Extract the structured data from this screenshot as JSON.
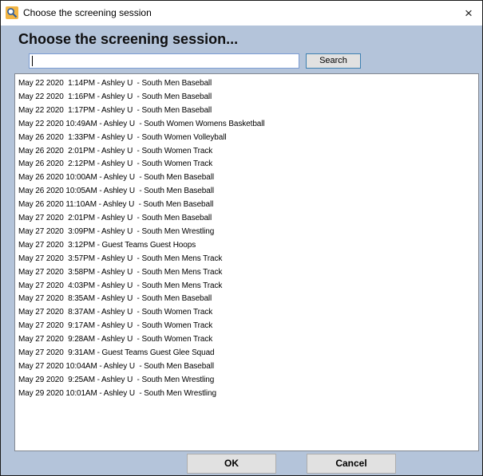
{
  "window": {
    "title": "Choose the screening session",
    "close_glyph": "×",
    "app_icon": "magnifier-icon"
  },
  "header": {
    "heading": "Choose the screening session..."
  },
  "search": {
    "value": "",
    "button_label": "Search"
  },
  "sessions": [
    "May 22 2020  1:14PM - Ashley U  - South Men Baseball",
    "May 22 2020  1:16PM - Ashley U  - South Men Baseball",
    "May 22 2020  1:17PM - Ashley U  - South Men Baseball",
    "May 22 2020 10:49AM - Ashley U  - South Women Womens Basketball",
    "May 26 2020  1:33PM - Ashley U  - South Women Volleyball",
    "May 26 2020  2:01PM - Ashley U  - South Women Track",
    "May 26 2020  2:12PM - Ashley U  - South Women Track",
    "May 26 2020 10:00AM - Ashley U  - South Men Baseball",
    "May 26 2020 10:05AM - Ashley U  - South Men Baseball",
    "May 26 2020 11:10AM - Ashley U  - South Men Baseball",
    "May 27 2020  2:01PM - Ashley U  - South Men Baseball",
    "May 27 2020  3:09PM - Ashley U  - South Men Wrestling",
    "May 27 2020  3:12PM - Guest Teams Guest Hoops",
    "May 27 2020  3:57PM - Ashley U  - South Men Mens Track",
    "May 27 2020  3:58PM - Ashley U  - South Men Mens Track",
    "May 27 2020  4:03PM - Ashley U  - South Men Mens Track",
    "May 27 2020  8:35AM - Ashley U  - South Men Baseball",
    "May 27 2020  8:37AM - Ashley U  - South Women Track",
    "May 27 2020  9:17AM - Ashley U  - South Women Track",
    "May 27 2020  9:28AM - Ashley U  - South Women Track",
    "May 27 2020  9:31AM - Guest Teams Guest Glee Squad",
    "May 27 2020 10:04AM - Ashley U  - South Men Baseball",
    "May 29 2020  9:25AM - Ashley U  - South Men Wrestling",
    "May 29 2020 10:01AM - Ashley U  - South Men Wrestling"
  ],
  "buttons": {
    "ok_label": "OK",
    "cancel_label": "Cancel"
  },
  "colors": {
    "dialog_background": "#b4c4da",
    "list_background": "#ffffff",
    "button_face": "#e1e1e1"
  }
}
